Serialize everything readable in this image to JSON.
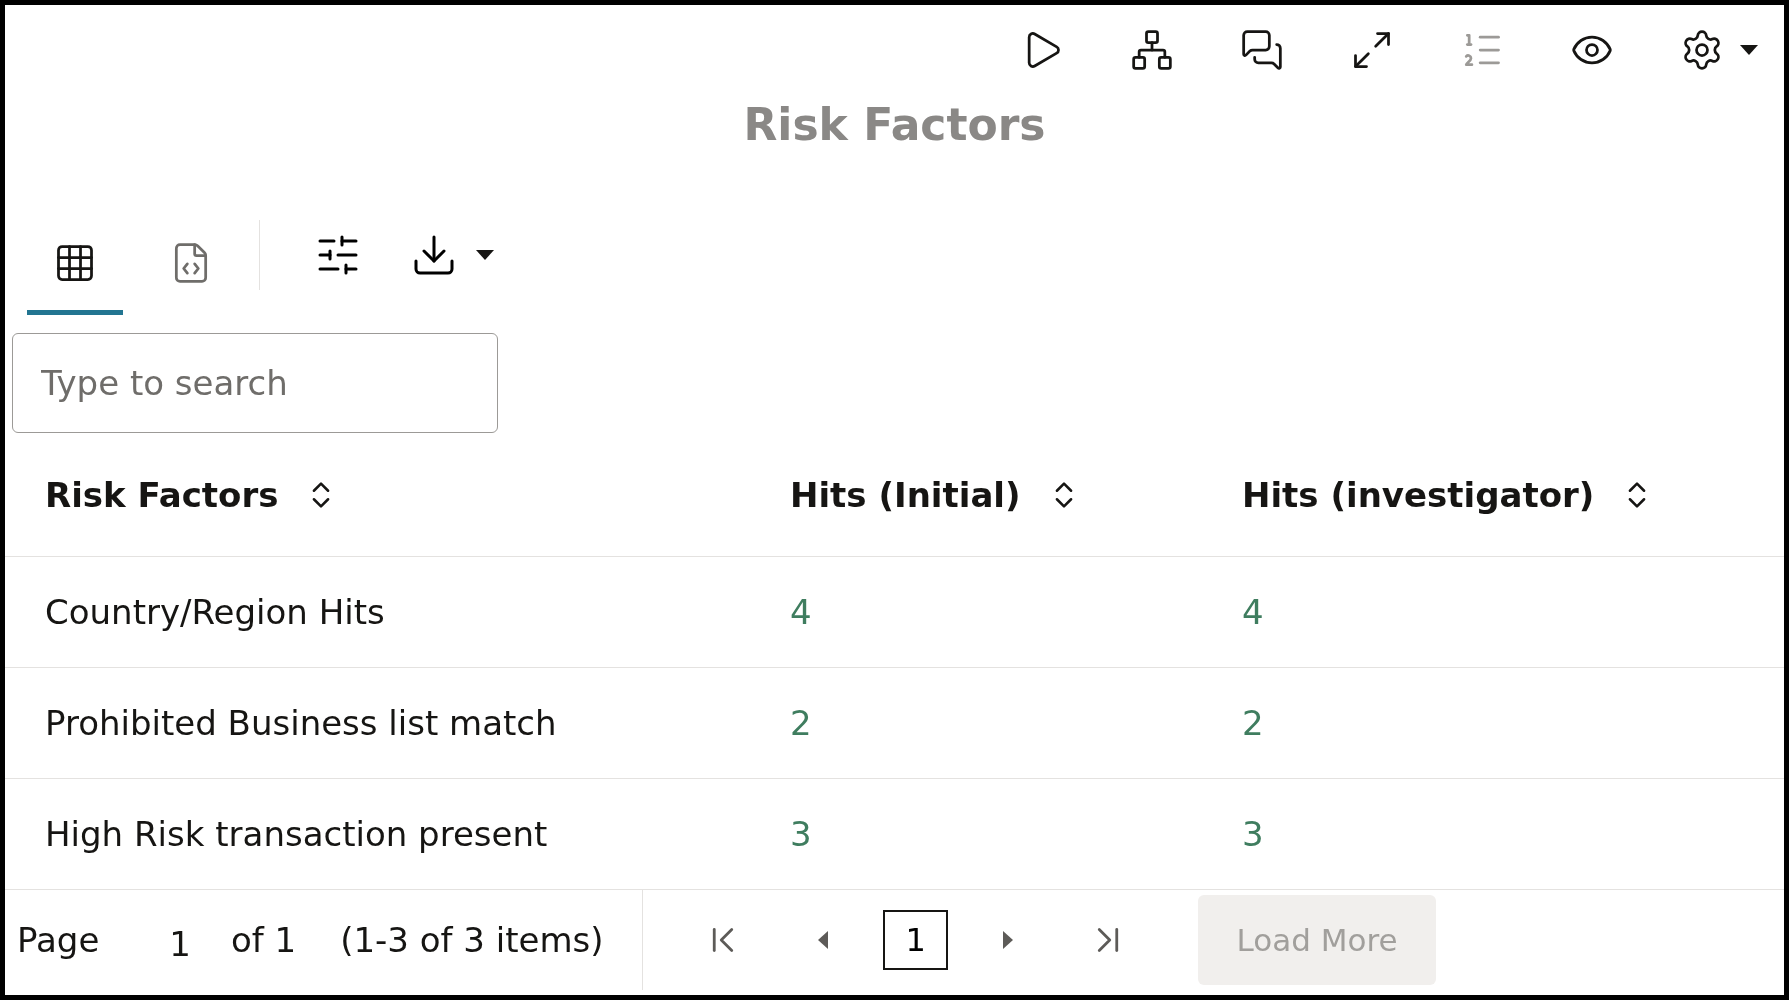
{
  "toolbar": [
    {
      "kind": "run",
      "disabled": false
    },
    {
      "kind": "hierarchy",
      "disabled": false
    },
    {
      "kind": "comments",
      "disabled": false
    },
    {
      "kind": "expand",
      "disabled": false
    },
    {
      "kind": "numbered-list",
      "disabled": true
    },
    {
      "kind": "view",
      "disabled": false
    },
    {
      "kind": "settings",
      "disabled": false
    }
  ],
  "title": "Risk Factors",
  "view_tabs": [
    {
      "kind": "table",
      "selected": true
    },
    {
      "kind": "code",
      "selected": false
    }
  ],
  "actions": [
    {
      "kind": "filter"
    },
    {
      "kind": "download"
    }
  ],
  "search": {
    "placeholder": "Type to search"
  },
  "table": {
    "columns": [
      "Risk Factors",
      "Hits (Initial)",
      "Hits (investigator)"
    ],
    "rows": [
      [
        "Country/Region Hits",
        "4",
        "4"
      ],
      [
        "Prohibited Business list match",
        "2",
        "2"
      ],
      [
        "High Risk transaction present",
        "3",
        "3"
      ]
    ]
  },
  "pagination": {
    "page_label": "Page",
    "page_value": "1",
    "of_total": "of 1",
    "range": "(1-3 of 3 items)",
    "nav": [
      {
        "kind": "first",
        "disabled": false
      },
      {
        "kind": "prev",
        "disabled": false
      },
      {
        "kind": "page",
        "label": "1"
      },
      {
        "kind": "next",
        "disabled": false
      },
      {
        "kind": "last",
        "disabled": false
      }
    ],
    "load_more": {
      "label": "Load More",
      "disabled": true
    }
  }
}
